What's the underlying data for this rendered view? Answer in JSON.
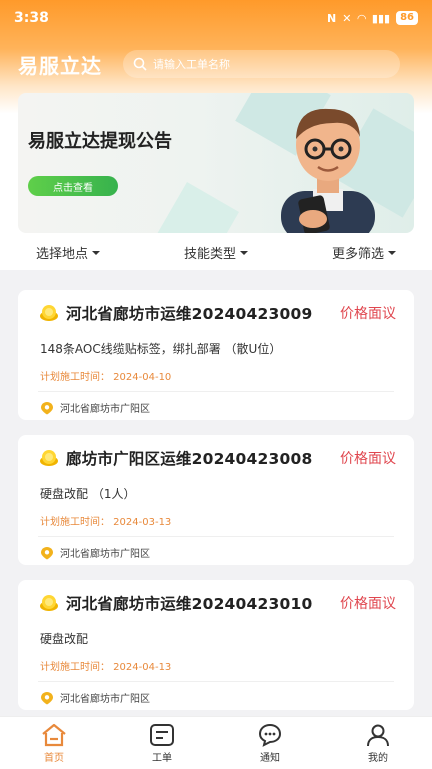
{
  "status_bar": {
    "time": "3:38",
    "battery": "86"
  },
  "header": {
    "app_title": "易服立达",
    "search_placeholder": "请输入工单名称"
  },
  "banner": {
    "title": "易服立达提现公告",
    "button": "点击查看"
  },
  "filters": [
    {
      "label": "选择地点"
    },
    {
      "label": "技能类型"
    },
    {
      "label": "更多筛选"
    }
  ],
  "orders": [
    {
      "title": "河北省廊坊市运维20240423009",
      "price": "价格面议",
      "desc": "148条AOC线缆贴标签，绑扎部署 （散U位）",
      "date": "计划施工时间：  2024-04-10",
      "location": "河北省廊坊市广阳区"
    },
    {
      "title": "廊坊市广阳区运维20240423008",
      "price": "价格面议",
      "desc": "硬盘改配 （1人）",
      "date": "计划施工时间：  2024-03-13",
      "location": "河北省廊坊市广阳区"
    },
    {
      "title": "河北省廊坊市运维20240423010",
      "price": "价格面议",
      "desc": "硬盘改配",
      "date": "计划施工时间：  2024-04-13",
      "location": "河北省廊坊市广阳区"
    }
  ],
  "tabbar": [
    {
      "label": "首页",
      "icon": "home-icon",
      "active": true
    },
    {
      "label": "工单",
      "icon": "workorder-icon"
    },
    {
      "label": "通知",
      "icon": "notification-icon"
    },
    {
      "label": "我的",
      "icon": "profile-icon"
    }
  ],
  "colors": {
    "accent": "#ff9a2a",
    "price": "#e0474f",
    "date": "#e8893b",
    "banner_button": "#37b24d"
  }
}
